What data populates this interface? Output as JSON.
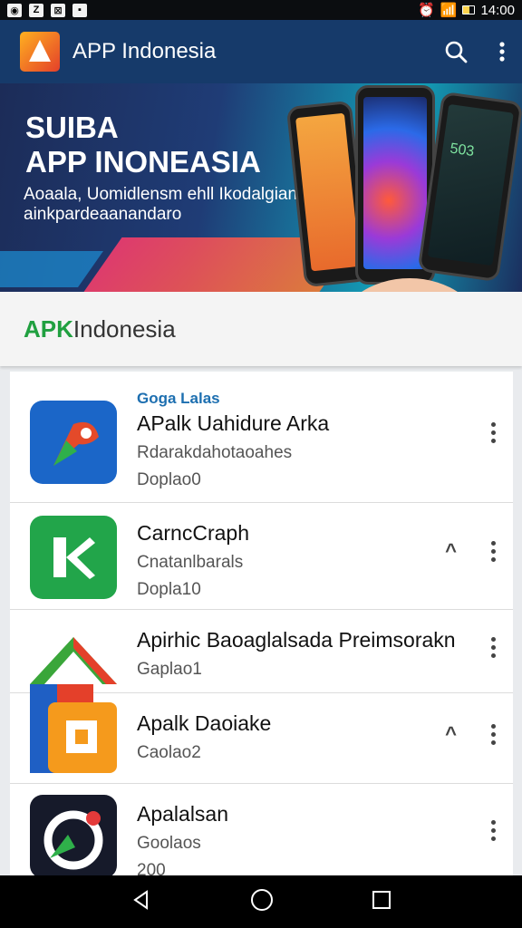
{
  "status_bar": {
    "time": "14:00",
    "left_icons": [
      "ring-icon",
      "z-icon",
      "gallery-icon",
      "photo-icon"
    ]
  },
  "app_bar": {
    "title": "APP Indonesia",
    "search_icon": "search-icon",
    "menu_icon": "more-vert-icon"
  },
  "banner": {
    "headline_1": "SUIBA",
    "headline_2": "APP INONEASIA",
    "sub_1": "Aoaala, Uomidlensm ehll Ikodalgian",
    "sub_2": "ainkpardeaanandaro",
    "phone_clock": "503"
  },
  "section_header": {
    "brand_a": "APK",
    "brand_rest": " Indonesia"
  },
  "list": [
    {
      "tag": "Goga Lalas",
      "name": "APalk Uahidure Arka",
      "line1": "Rdarakdahotaoahes",
      "line2": "Doplao0",
      "chevron": false
    },
    {
      "tag": "",
      "name": "CarncCraph",
      "line1": "Cnatanlbarals",
      "line2": "Dopla10",
      "chevron": true
    },
    {
      "tag": "",
      "name": "Apirhic Baoaglalsada Preimsorakn",
      "line1": "Gaplao1",
      "line2": "",
      "chevron": false
    },
    {
      "tag": "",
      "name": "Apalk Daoiake",
      "line1": "Caolao2",
      "line2": "",
      "chevron": true
    },
    {
      "tag": "",
      "name": "Apalalsan",
      "line1": "Goolaos",
      "line2": "200",
      "chevron": false
    }
  ],
  "colors": {
    "app_bar": "#163a6a",
    "brand_green": "#20a040",
    "tag_blue": "#1d6fb0"
  },
  "nav": {
    "back": "back-icon",
    "home": "home-icon",
    "recents": "recents-icon"
  }
}
